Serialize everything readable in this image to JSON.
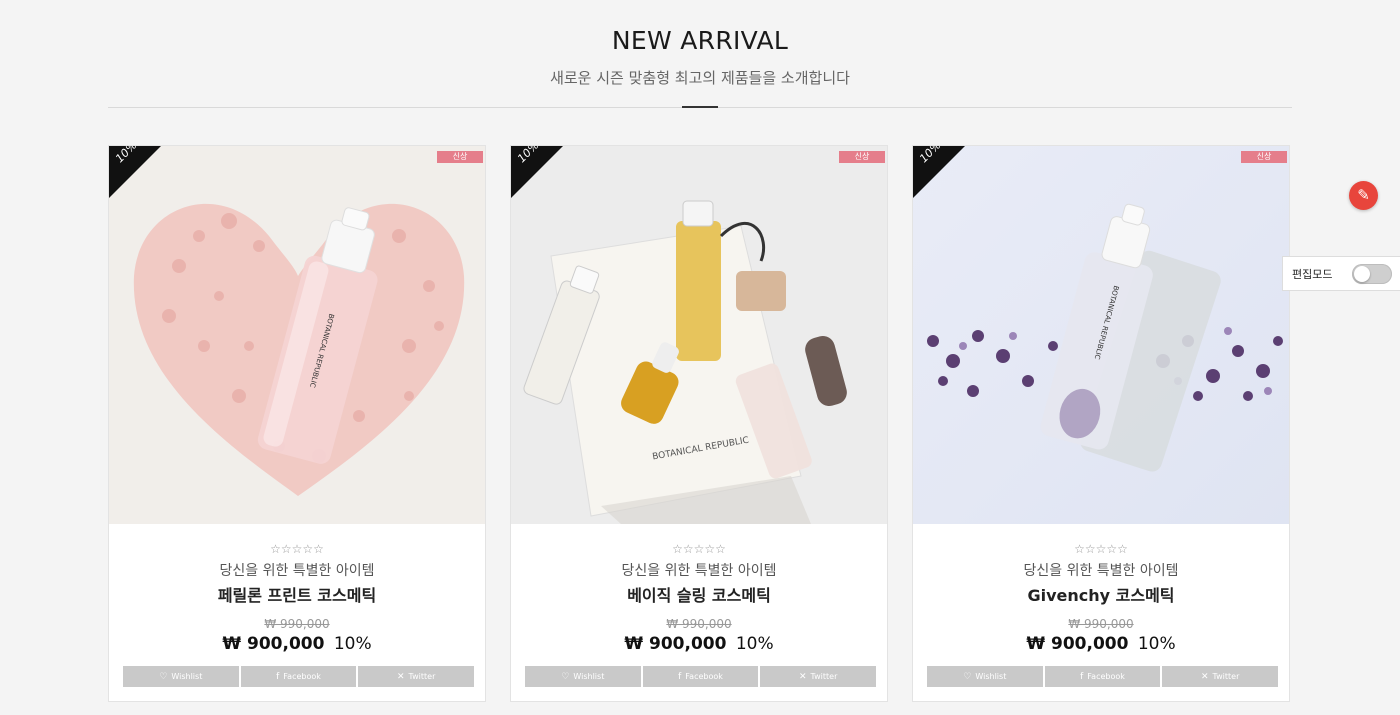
{
  "section": {
    "title": "NEW ARRIVAL",
    "subtitle": "새로운 시즌 맞춤형 최고의 제품들을 소개합니다"
  },
  "products": [
    {
      "discount_corner": "10%",
      "badge": "신상",
      "rating_stars": "☆☆☆☆☆",
      "tagline": "당신을 위한 특별한 아이템",
      "name": "페릴론 프린트 코스메틱",
      "original_price": "₩ 990,000",
      "price": "₩ 900,000",
      "discount": "10%",
      "bottle_label": "BOTANICAL REPUBLIC",
      "image_bg": "#f2efec"
    },
    {
      "discount_corner": "10%",
      "badge": "신상",
      "rating_stars": "☆☆☆☆☆",
      "tagline": "당신을 위한 특별한 아이템",
      "name": "베이직 슬링 코스메틱",
      "original_price": "₩ 990,000",
      "price": "₩ 900,000",
      "discount": "10%",
      "bottle_label": "BOTANICAL REPUBLIC",
      "image_bg": "#ececec"
    },
    {
      "discount_corner": "10%",
      "badge": "신상",
      "rating_stars": "☆☆☆☆☆",
      "tagline": "당신을 위한 특별한 아이템",
      "name": "Givenchy 코스메틱",
      "original_price": "₩ 990,000",
      "price": "₩ 900,000",
      "discount": "10%",
      "bottle_label": "BOTANICAL REPUBLIC",
      "image_bg": "#e6e9f3"
    }
  ],
  "share": {
    "wishlist": "Wishlist",
    "facebook": "Facebook",
    "twitter": "Twitter",
    "wishlist_icon": "heart-icon",
    "facebook_icon": "facebook-icon",
    "twitter_icon": "x-icon"
  },
  "editor": {
    "label": "편집모드",
    "toggle_on": false,
    "float_icon": "feather-icon"
  },
  "colors": {
    "accent": "#e57e8b",
    "float": "#e8453c",
    "button": "#c9c9c9"
  }
}
